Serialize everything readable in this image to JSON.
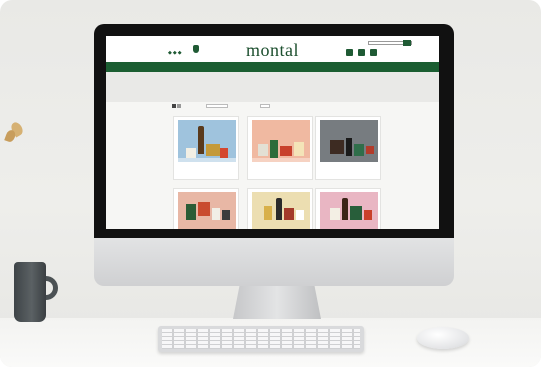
{
  "brand": {
    "logo_text": "montal",
    "accent_color": "#1b5e32"
  },
  "header": {
    "flag_icons": [
      "flag-icon",
      "flag-icon",
      "flag-icon"
    ],
    "search_icon": "search-icon",
    "tools": [
      {
        "icon": "user-icon",
        "label": ""
      },
      {
        "icon": "cart-icon",
        "label": ""
      },
      {
        "icon": "bag-icon",
        "label": ""
      }
    ]
  },
  "nav": {
    "items": [
      {
        "label": ""
      },
      {
        "label": ""
      },
      {
        "label": ""
      },
      {
        "label": ""
      },
      {
        "label": ""
      }
    ]
  },
  "category": {
    "title": "",
    "breadcrumb": ""
  },
  "toolbar": {
    "sort_label": "",
    "show_label": "",
    "view_icons": [
      "grid-icon",
      "list-icon"
    ]
  },
  "products": [
    {
      "name": "",
      "price": ""
    },
    {
      "name": "",
      "price": ""
    },
    {
      "name": "",
      "price": ""
    },
    {
      "name": "",
      "price": ""
    },
    {
      "name": "",
      "price": ""
    },
    {
      "name": "",
      "price": ""
    }
  ]
}
